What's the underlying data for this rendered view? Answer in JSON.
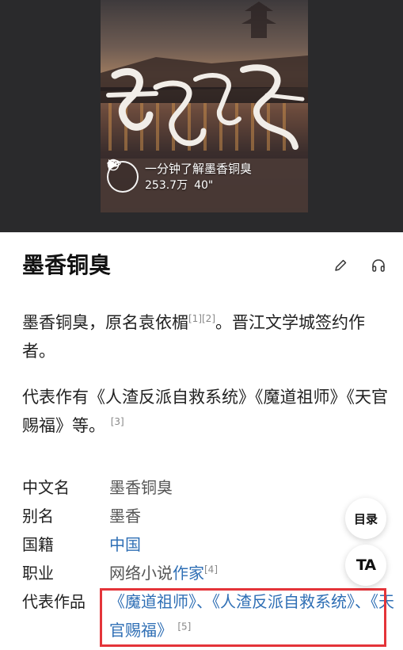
{
  "video": {
    "title": "一分钟了解墨香铜臭",
    "views": "253.7万",
    "duration": "40\"",
    "icons": [
      "play-icon",
      "eye-icon",
      "clock-icon"
    ],
    "calligraphy": "墨香铜臭"
  },
  "entry": {
    "title": "墨香铜臭",
    "icons": [
      "edit-icon",
      "headphones-icon"
    ],
    "intro": {
      "text": "墨香铜臭，原名袁依楣",
      "refs": "[1][2]",
      "text2": "。晋江文学城签约作者。"
    },
    "works_summary": {
      "text": "代表作有《人渣反派自救系统》《魔道祖师》《天官赐福》等。",
      "ref": "[3]"
    }
  },
  "info": {
    "rows": [
      {
        "label": "中文名",
        "value": "墨香铜臭"
      },
      {
        "label": "别名",
        "value": "墨香"
      },
      {
        "label": "国籍",
        "value": "中国"
      },
      {
        "label": "职业",
        "value": "网络小说",
        "link": "作家",
        "ref": "[4]"
      },
      {
        "label": "代表作品",
        "value": "《魔道祖师》、《人渣反派自救系统》、《天官赐福》",
        "ref": "[5]"
      }
    ]
  },
  "floating": {
    "toc": "目录",
    "ta": "TA"
  },
  "colors": {
    "link": "#2f6fb5",
    "highlight": "#e43439",
    "banner_bg": "#2a2a2c"
  }
}
